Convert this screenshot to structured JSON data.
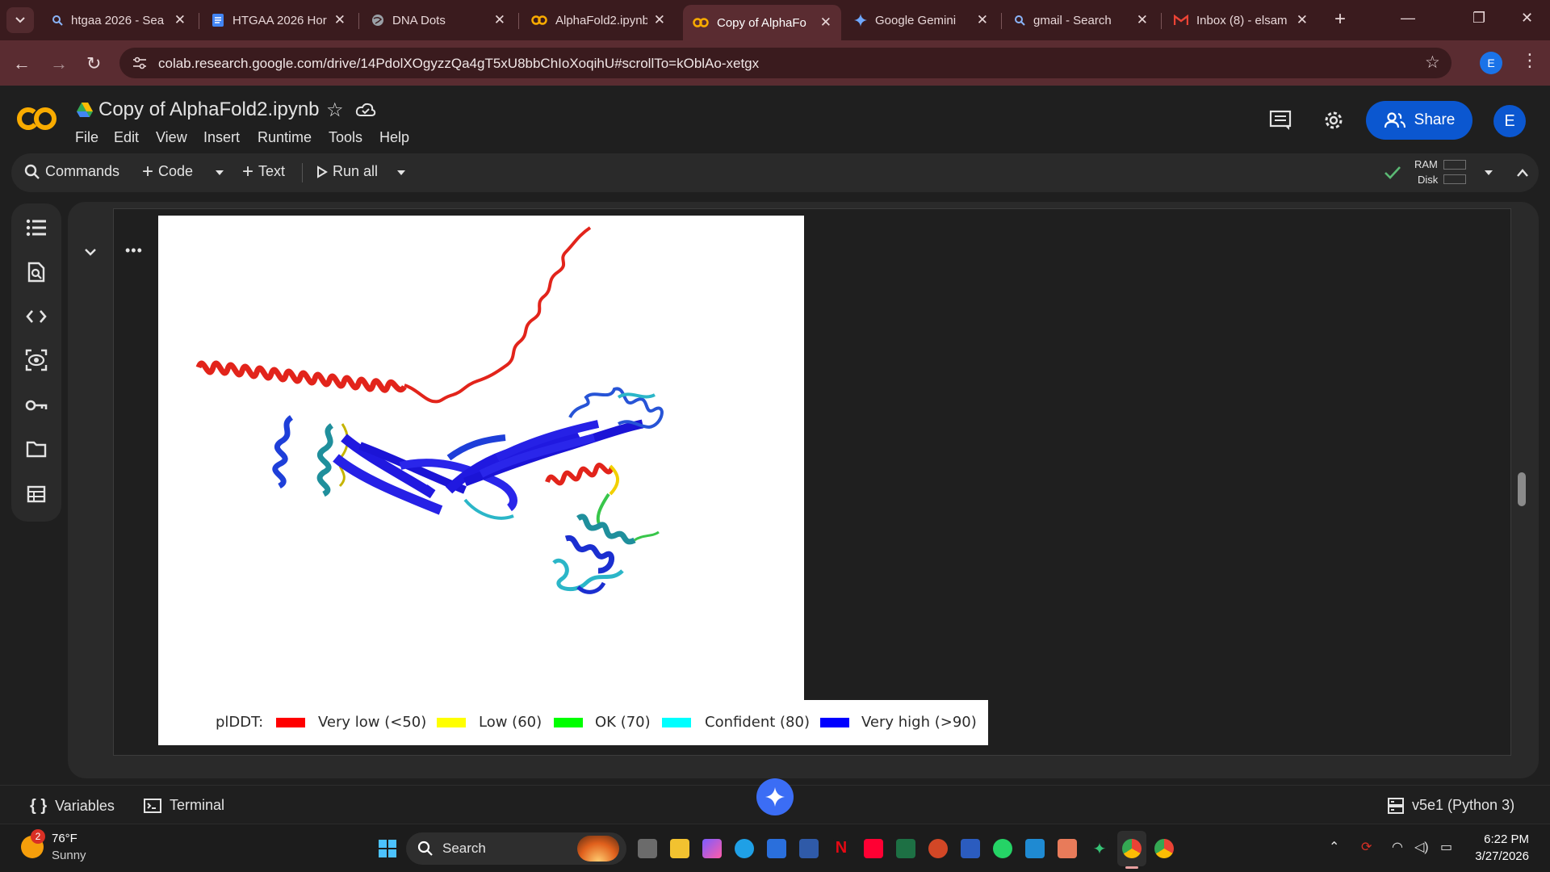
{
  "browser": {
    "tabs": [
      {
        "title": "htgaa 2026 - Sea",
        "icon": "search-icon"
      },
      {
        "title": "HTGAA 2026 Hor",
        "icon": "docs-icon"
      },
      {
        "title": "DNA Dots",
        "icon": "globe-icon"
      },
      {
        "title": "AlphaFold2.ipynb",
        "icon": "colab-icon"
      },
      {
        "title": "Copy of AlphaFo",
        "icon": "colab-icon",
        "active": true
      },
      {
        "title": "Google Gemini",
        "icon": "gemini-icon"
      },
      {
        "title": "gmail - Search",
        "icon": "search-icon"
      },
      {
        "title": "Inbox (8) - elsam",
        "icon": "gmail-icon"
      }
    ],
    "url": "colab.research.google.com/drive/14PdolXOgyzzQa4gT5xU8bbChIoXoqihU#scrollTo=kOblAo-xetgx",
    "profile_initial": "E"
  },
  "colab": {
    "notebook_title": "Copy of AlphaFold2.ipynb",
    "menu": [
      "File",
      "Edit",
      "View",
      "Insert",
      "Runtime",
      "Tools",
      "Help"
    ],
    "share_label": "Share",
    "user_initial": "E",
    "toolbar": {
      "commands": "Commands",
      "code": "Code",
      "text": "Text",
      "run_all": "Run all",
      "ram": "RAM",
      "disk": "Disk"
    }
  },
  "output": {
    "legend": {
      "title": "plDDT:",
      "entries": [
        {
          "label": "Very low (<50)",
          "color": "#ff0000"
        },
        {
          "label": "Low (60)",
          "color": "#ffff00"
        },
        {
          "label": "OK (70)",
          "color": "#00ff00"
        },
        {
          "label": "Confident (80)",
          "color": "#00ffff"
        },
        {
          "label": "Very high (>90)",
          "color": "#0000ff"
        }
      ]
    }
  },
  "statusbar": {
    "variables": "Variables",
    "terminal": "Terminal",
    "runtime": "v5e1 (Python 3)"
  },
  "taskbar": {
    "weather_temp": "76°F",
    "weather_cond": "Sunny",
    "weather_badge": "2",
    "search": "Search",
    "time": "6:22 PM",
    "date": "3/27/2026"
  }
}
